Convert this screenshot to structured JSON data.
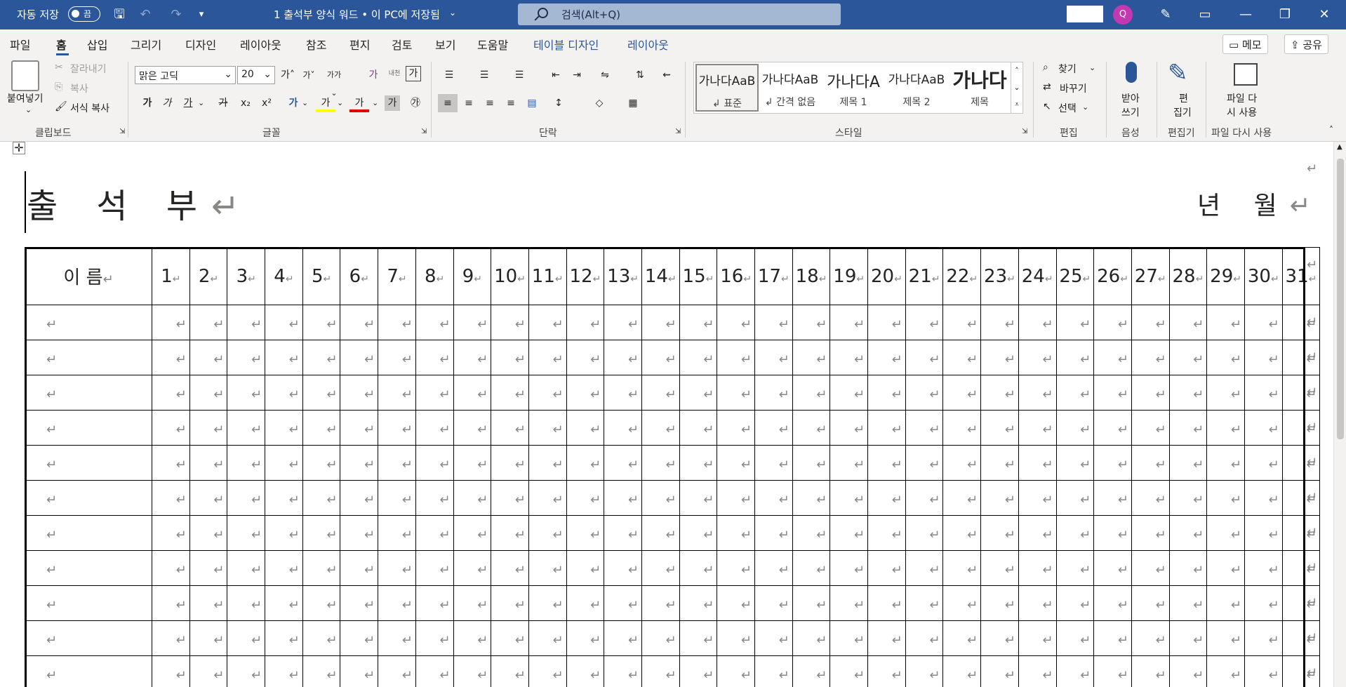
{
  "titlebar": {
    "autosave_label": "자동 저장",
    "autosave_state": "끔",
    "doc_title": "1 출석부 양식 워드 • 이 PC에 저장됨",
    "search_placeholder": "검색(Alt+Q)",
    "avatar_initial": "Q",
    "bg_color": "#2b579a"
  },
  "tabs": {
    "items": [
      "파일",
      "홈",
      "삽입",
      "그리기",
      "디자인",
      "레이아웃",
      "참조",
      "편지",
      "검토",
      "보기",
      "도움말"
    ],
    "contextual": [
      "테이블 디자인",
      "레이아웃"
    ],
    "memo_label": "메모",
    "share_label": "공유"
  },
  "ribbon": {
    "clipboard": {
      "paste": "붙여넣기",
      "cut": "잘라내기",
      "copy": "복사",
      "format_painter": "서식 복사",
      "label": "클립보드"
    },
    "font": {
      "family": "맑은 고딕",
      "size": "20",
      "grow": "가",
      "shrink": "가",
      "phonetic": "가가",
      "clear": "가",
      "bold": "가",
      "italic": "가",
      "underline": "가",
      "strike": "가",
      "sub": "x₂",
      "sup": "x²",
      "label": "글꼴",
      "wrap_label": "내천",
      "box_char": "가",
      "highlight": "가",
      "fontcolor": "가",
      "shade": "가",
      "enclosed": "㉮"
    },
    "paragraph": {
      "label": "단락"
    },
    "styles": {
      "items": [
        {
          "preview": "가나다AaB",
          "name": "↲ 표준"
        },
        {
          "preview": "가나다AaB",
          "name": "↲ 간격 없음"
        },
        {
          "preview": "가나다A",
          "name": "제목 1"
        },
        {
          "preview": "가나다AaB",
          "name": "제목 2"
        },
        {
          "preview": "가나다",
          "name": "제목"
        }
      ],
      "label": "스타일"
    },
    "editing": {
      "find": "찾기",
      "replace": "바꾸기",
      "select": "선택",
      "label": "편집"
    },
    "voice": {
      "dictate_l1": "받아",
      "dictate_l2": "쓰기",
      "label": "음성"
    },
    "editor": {
      "l1": "편",
      "l2": "집기",
      "label": "편집기"
    },
    "reuse": {
      "l1": "파일 다",
      "l2": "시 사용",
      "label": "파일 다시 사용"
    }
  },
  "document": {
    "title": "출 석 부",
    "date_label": "년 월",
    "pmark": "↵",
    "name_header": "이 름",
    "days": [
      "1",
      "2",
      "3",
      "4",
      "5",
      "6",
      "7",
      "8",
      "9",
      "10",
      "11",
      "12",
      "13",
      "14",
      "15",
      "16",
      "17",
      "18",
      "19",
      "20",
      "21",
      "22",
      "23",
      "24",
      "25",
      "26",
      "27",
      "28",
      "29",
      "30",
      "31"
    ]
  }
}
